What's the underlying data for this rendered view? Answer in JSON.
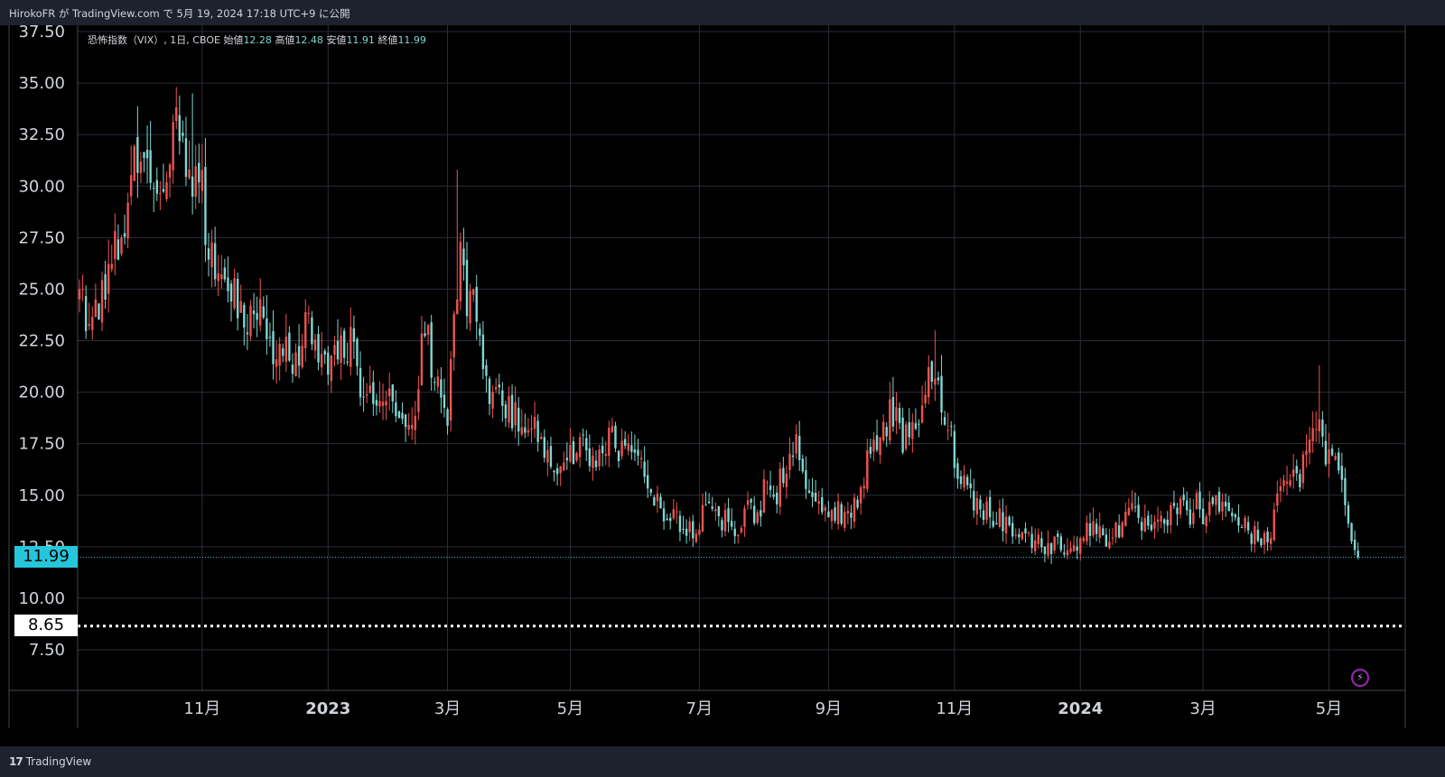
{
  "header": {
    "publish_text": "HirokoFR が TradingView.com で 5月 19, 2024 17:18 UTC+9 に公開"
  },
  "legend": {
    "symbol_text": "恐怖指数（VIX）, 1日, CBOE",
    "open_label": "始値",
    "open": "12.28",
    "high_label": "高値",
    "high": "12.48",
    "low_label": "安値",
    "low": "11.91",
    "close_label": "終値",
    "close": "11.99"
  },
  "price_tags": {
    "last": "11.99",
    "level": "8.65"
  },
  "footer": {
    "brand": "TradingView"
  },
  "colors": {
    "up": "#ef5350",
    "down": "#7fd6d2",
    "grid": "#2a2e39",
    "last_tag": "#26c6da",
    "level_line": "#ffffff"
  },
  "icons": [
    "tradingview-logo-icon",
    "lightning-icon"
  ],
  "chart_data": {
    "type": "candlestick",
    "ylim": [
      5.0,
      38.0
    ],
    "y_ticks": [
      "37.50",
      "35.00",
      "32.50",
      "30.00",
      "27.50",
      "25.00",
      "22.50",
      "20.00",
      "17.50",
      "15.00",
      "12.50",
      "10.00",
      "7.50"
    ],
    "x_ticks": [
      {
        "label": "11月",
        "bold": false,
        "idx": 38
      },
      {
        "label": "2023",
        "bold": true,
        "idx": 77
      },
      {
        "label": "3月",
        "bold": false,
        "idx": 114
      },
      {
        "label": "5月",
        "bold": false,
        "idx": 152
      },
      {
        "label": "7月",
        "bold": false,
        "idx": 192
      },
      {
        "label": "9月",
        "bold": false,
        "idx": 232
      },
      {
        "label": "11月",
        "bold": false,
        "idx": 271
      },
      {
        "label": "2024",
        "bold": true,
        "idx": 310
      },
      {
        "label": "3月",
        "bold": false,
        "idx": 348
      },
      {
        "label": "5月",
        "bold": false,
        "idx": 387
      }
    ],
    "n_bars": 397,
    "closes_anchor": [
      [
        0,
        24.5
      ],
      [
        4,
        23.3
      ],
      [
        10,
        26.5
      ],
      [
        14,
        27.2
      ],
      [
        18,
        32.0
      ],
      [
        22,
        31.0
      ],
      [
        26,
        29.2
      ],
      [
        28,
        31.5
      ],
      [
        30,
        33.8
      ],
      [
        33,
        31.5
      ],
      [
        36,
        30.0
      ],
      [
        38,
        29.5
      ],
      [
        40,
        27.0
      ],
      [
        44,
        25.8
      ],
      [
        48,
        25.0
      ],
      [
        52,
        23.5
      ],
      [
        56,
        23.8
      ],
      [
        60,
        21.0
      ],
      [
        64,
        22.5
      ],
      [
        67,
        21.0
      ],
      [
        70,
        24.0
      ],
      [
        73,
        22.0
      ],
      [
        77,
        21.8
      ],
      [
        80,
        22.5
      ],
      [
        84,
        22.2
      ],
      [
        88,
        20.0
      ],
      [
        92,
        19.5
      ],
      [
        96,
        20.0
      ],
      [
        100,
        18.3
      ],
      [
        104,
        19.6
      ],
      [
        107,
        23.0
      ],
      [
        110,
        21.0
      ],
      [
        113,
        20.0
      ],
      [
        114,
        19.0
      ],
      [
        116,
        23.0
      ],
      [
        118,
        27.5
      ],
      [
        120,
        23.0
      ],
      [
        122,
        26.0
      ],
      [
        126,
        20.0
      ],
      [
        130,
        19.5
      ],
      [
        134,
        19.0
      ],
      [
        138,
        18.8
      ],
      [
        142,
        18.0
      ],
      [
        146,
        16.5
      ],
      [
        150,
        16.5
      ],
      [
        152,
        16.8
      ],
      [
        155,
        17.5
      ],
      [
        158,
        17.0
      ],
      [
        161,
        16.5
      ],
      [
        164,
        18.0
      ],
      [
        168,
        17.0
      ],
      [
        172,
        17.8
      ],
      [
        175,
        16.0
      ],
      [
        178,
        14.8
      ],
      [
        181,
        14.3
      ],
      [
        185,
        14.0
      ],
      [
        188,
        13.5
      ],
      [
        192,
        13.5
      ],
      [
        194,
        15.0
      ],
      [
        196,
        13.8
      ],
      [
        200,
        13.7
      ],
      [
        204,
        13.5
      ],
      [
        207,
        14.2
      ],
      [
        210,
        13.8
      ],
      [
        213,
        16.0
      ],
      [
        216,
        15.2
      ],
      [
        219,
        16.5
      ],
      [
        222,
        17.5
      ],
      [
        225,
        15.5
      ],
      [
        228,
        14.5
      ],
      [
        231,
        14.0
      ],
      [
        232,
        13.8
      ],
      [
        234,
        14.2
      ],
      [
        237,
        14.0
      ],
      [
        240,
        14.3
      ],
      [
        243,
        16.0
      ],
      [
        246,
        17.5
      ],
      [
        249,
        18.5
      ],
      [
        252,
        19.0
      ],
      [
        255,
        17.5
      ],
      [
        258,
        18.0
      ],
      [
        260,
        19.0
      ],
      [
        263,
        20.5
      ],
      [
        266,
        20.0
      ],
      [
        268,
        19.0
      ],
      [
        271,
        17.0
      ],
      [
        273,
        16.0
      ],
      [
        276,
        15.0
      ],
      [
        280,
        14.4
      ],
      [
        284,
        14.0
      ],
      [
        288,
        13.5
      ],
      [
        292,
        13.0
      ],
      [
        296,
        12.8
      ],
      [
        300,
        12.5
      ],
      [
        304,
        12.6
      ],
      [
        308,
        12.7
      ],
      [
        310,
        12.8
      ],
      [
        314,
        13.5
      ],
      [
        318,
        13.0
      ],
      [
        322,
        13.5
      ],
      [
        326,
        14.0
      ],
      [
        330,
        13.5
      ],
      [
        333,
        13.3
      ],
      [
        336,
        13.5
      ],
      [
        340,
        14.5
      ],
      [
        343,
        14.0
      ],
      [
        346,
        14.5
      ],
      [
        348,
        14.0
      ],
      [
        352,
        14.5
      ],
      [
        356,
        14.5
      ],
      [
        360,
        13.5
      ],
      [
        364,
        13.0
      ],
      [
        368,
        13.0
      ],
      [
        371,
        14.5
      ],
      [
        374,
        16.0
      ],
      [
        377,
        15.5
      ],
      [
        380,
        16.8
      ],
      [
        382,
        18.0
      ],
      [
        384,
        19.2
      ],
      [
        386,
        17.2
      ],
      [
        387,
        17.0
      ],
      [
        389,
        16.5
      ],
      [
        391,
        15.5
      ],
      [
        393,
        14.0
      ],
      [
        394,
        13.2
      ],
      [
        395,
        12.8
      ],
      [
        396,
        11.99
      ]
    ],
    "notable_highs": [
      [
        30,
        34.8
      ],
      [
        35,
        34.5
      ],
      [
        117,
        30.8
      ],
      [
        265,
        23.0
      ],
      [
        384,
        21.3
      ]
    ],
    "last_price": 11.99,
    "horizontal_level": 8.65
  }
}
